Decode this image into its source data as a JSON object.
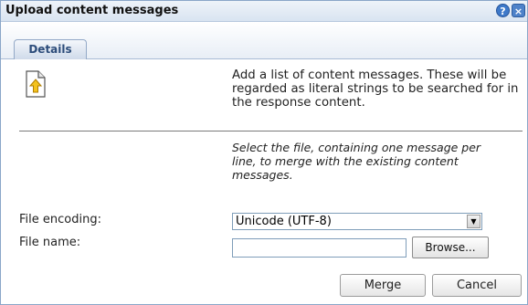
{
  "dialog": {
    "title": "Upload content messages",
    "help_glyph": "?",
    "close_glyph": "×"
  },
  "tabs": [
    {
      "label": "Details"
    }
  ],
  "content": {
    "icon": "document-upload-icon",
    "description": "Add a list of content messages. These will be regarded as literal strings to be searched for in the response content.",
    "hint": "Select the file, containing one message per line, to merge with the existing content messages."
  },
  "form": {
    "encoding_label": "File encoding:",
    "encoding_value": "Unicode (UTF-8)",
    "filename_label": "File name:",
    "filename_value": "",
    "browse_label": "Browse..."
  },
  "footer": {
    "merge_label": "Merge",
    "cancel_label": "Cancel"
  }
}
